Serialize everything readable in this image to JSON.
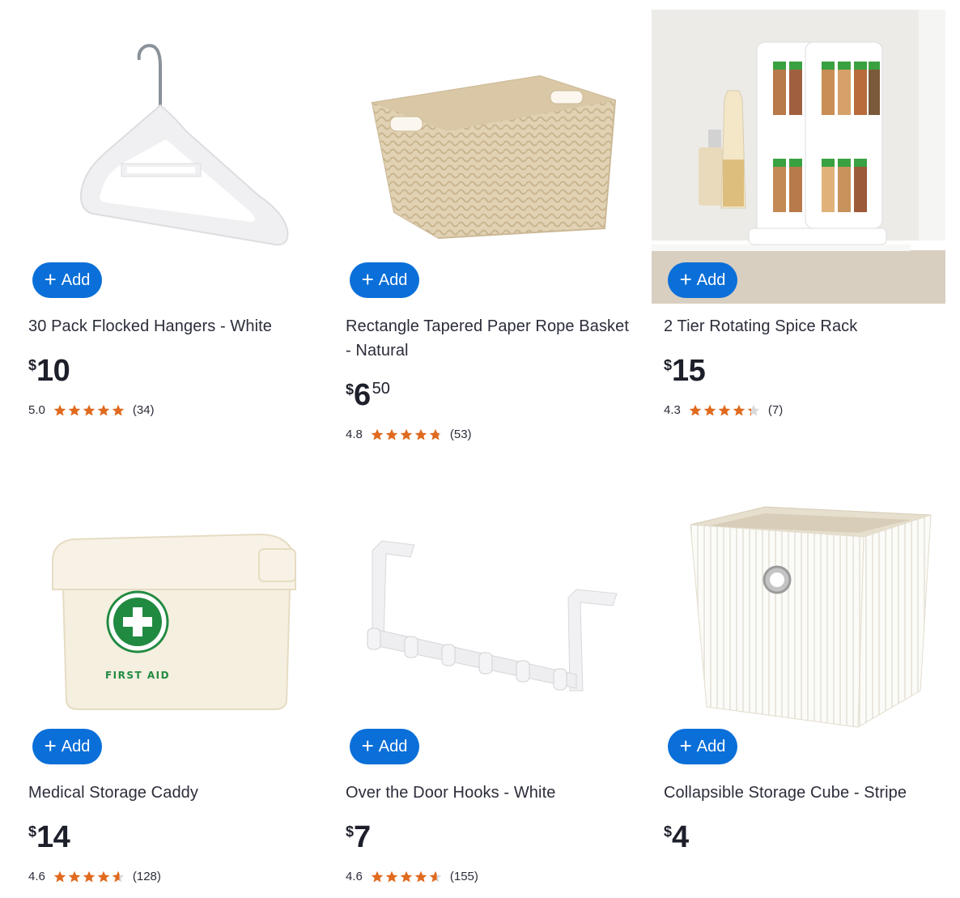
{
  "products": [
    {
      "title": "30 Pack Flocked Hangers - White",
      "cur": "$",
      "dollars": "10",
      "cents": "",
      "rating": "5.0",
      "stars": 5.0,
      "count": "(34)",
      "add_label": "Add",
      "icon": "hanger"
    },
    {
      "title": "Rectangle Tapered Paper Rope Basket - Natural",
      "cur": "$",
      "dollars": "6",
      "cents": "50",
      "rating": "4.8",
      "stars": 4.8,
      "count": "(53)",
      "add_label": "Add",
      "icon": "basket"
    },
    {
      "title": "2 Tier Rotating Spice Rack",
      "cur": "$",
      "dollars": "15",
      "cents": "",
      "rating": "4.3",
      "stars": 4.3,
      "count": "(7)",
      "add_label": "Add",
      "icon": "spice-rack"
    },
    {
      "title": "Medical Storage Caddy",
      "cur": "$",
      "dollars": "14",
      "cents": "",
      "rating": "4.6",
      "stars": 4.6,
      "count": "(128)",
      "add_label": "Add",
      "icon": "first-aid-caddy",
      "print": "FIRST AID"
    },
    {
      "title": "Over the Door Hooks - White",
      "cur": "$",
      "dollars": "7",
      "cents": "",
      "rating": "4.6",
      "stars": 4.6,
      "count": "(155)",
      "add_label": "Add",
      "icon": "door-hooks"
    },
    {
      "title": "Collapsible Storage Cube - Stripe",
      "cur": "$",
      "dollars": "4",
      "cents": "",
      "rating": "",
      "stars": 0,
      "count": "",
      "add_label": "Add",
      "icon": "storage-cube"
    }
  ],
  "colors": {
    "accent": "#0a6fd8",
    "star": "#e06a1f",
    "star_empty": "#d9d9d9",
    "text": "#2b2d3a"
  }
}
